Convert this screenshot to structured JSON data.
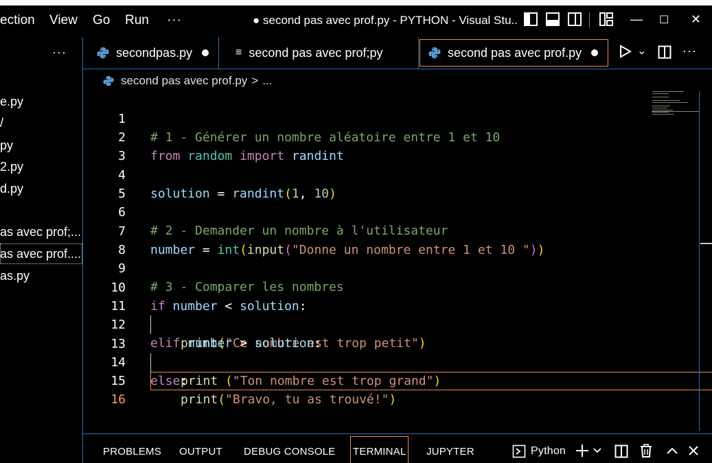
{
  "menu": [
    "ection",
    "View",
    "Go",
    "Run",
    "···"
  ],
  "window_title": "● second pas avec prof.py - PYTHON - Visual Stu...",
  "window_controls": {
    "minimize": "—",
    "maximize": "☐",
    "close": "✕"
  },
  "title_icons": [
    "toggle-primary-sidebar-icon",
    "toggle-panel-icon",
    "toggle-secondary-sidebar-icon",
    "customize-layout-icon"
  ],
  "sidebar": {
    "more": "···",
    "items": [
      {
        "label": "e.py"
      },
      {
        "label": "/"
      },
      {
        "label": "py"
      },
      {
        "label": "2.py"
      },
      {
        "label": "d.py"
      },
      {
        "label": "as avec prof;..."
      },
      {
        "label": "as avec prof...."
      },
      {
        "label": "as.py"
      }
    ]
  },
  "tabs": [
    {
      "label": "secondpas.py",
      "icon": "python-icon",
      "modified": true
    },
    {
      "label": "second pas avec prof;py",
      "icon": "text-file-icon",
      "modified": false
    },
    {
      "label": "second pas avec prof.py",
      "icon": "python-icon",
      "modified": true,
      "active": true
    }
  ],
  "editor_actions": {
    "run": "▷",
    "run_menu": "⌄",
    "split": "split-editor-icon",
    "more": "···"
  },
  "breadcrumb": {
    "file": "second pas avec prof.py",
    "separator": ">",
    "rest": "..."
  },
  "code": {
    "line_numbers": [
      "1",
      "2",
      "3",
      "4",
      "5",
      "6",
      "7",
      "8",
      "9",
      "10",
      "11",
      "12",
      "13",
      "14",
      "15",
      "16"
    ],
    "l1": "# 1 - Générer un nombre aléatoire entre 1 et 10",
    "l2": {
      "a": "from",
      "b": " ",
      "c": "random",
      "d": " ",
      "e": "import",
      "f": " ",
      "g": "randint"
    },
    "l4": {
      "a": "solution",
      "b": " = ",
      "c": "randint",
      "d": "(",
      "e": "1",
      "f": ", ",
      "g": "10",
      "h": ")"
    },
    "l6": "# 2 - Demander un nombre à l'utilisateur",
    "l7": {
      "a": "number",
      "b": " = ",
      "c": "int",
      "d": "(",
      "e": "input",
      "f": "(",
      "g": "\"Donne un nombre entre 1 et 10 \"",
      "h": ")",
      "i": ")"
    },
    "l9": "# 3 - Comparer les nombres",
    "l10": {
      "a": "if",
      "b": " ",
      "c": "number",
      "d": " < ",
      "e": "solution",
      "f": ":"
    },
    "l11": {
      "a": "print",
      "b": "(",
      "c": "\"Ce nombre est trop petit\"",
      "d": ")"
    },
    "l12": {
      "a": "elif",
      "b": " ",
      "c": "number",
      "d": " > ",
      "e": "solution",
      "f": ":"
    },
    "l13": {
      "a": "print",
      "b": " ",
      "c": "(",
      "d": "\"Ton nombre est trop grand\"",
      "e": ")"
    },
    "l14": {
      "a": "else",
      "b": ":"
    },
    "l15": {
      "a": "print",
      "b": "(",
      "c": "\"Bravo, tu as trouvé!\"",
      "d": ")"
    },
    "current_line": "16"
  },
  "panel": {
    "tabs": [
      "PROBLEMS",
      "OUTPUT",
      "DEBUG CONSOLE",
      "TERMINAL",
      "JUPYTER"
    ],
    "active_tab": "TERMINAL",
    "terminal_name": "Python",
    "actions": [
      "terminal-icon",
      "add-terminal-icon",
      "chevron-down-icon",
      "split-terminal-icon",
      "trash-icon",
      "maximize-panel-icon",
      "close-panel-icon"
    ]
  },
  "colors": {
    "border": "#2a6fb5",
    "focus": "#f08a4b",
    "comment": "#7ca668",
    "keyword": "#c586c0",
    "variable": "#9cdcfe",
    "function": "#dcdcaa",
    "string": "#ce9178",
    "number": "#b5cea8",
    "module": "#4ec9b0"
  }
}
